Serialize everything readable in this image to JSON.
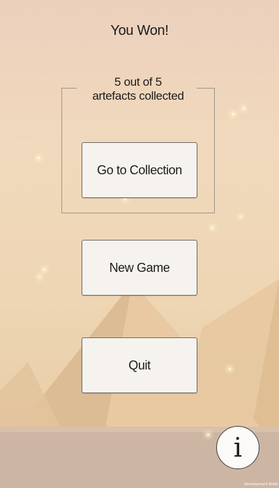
{
  "screen": {
    "title": "You Won!",
    "collection_summary": {
      "line1": "5 out of 5",
      "line2": "artefacts collected",
      "collected": 5,
      "total": 5
    },
    "buttons": {
      "go_to_collection": "Go to Collection",
      "new_game": "New Game",
      "quit": "Quit",
      "info": "i"
    },
    "footer": {
      "build_label": "Development Build"
    }
  },
  "colors": {
    "sky_top": "#ecd0bd",
    "sand": "#e7c9a2",
    "pyramid_light": "#e8c9a0",
    "pyramid_shadow": "#d7b48c",
    "ground": "#cfb7a6",
    "button_fill": "#f6f3ee",
    "text": "#1c1c1c"
  },
  "icons": {
    "info": "info-icon"
  }
}
